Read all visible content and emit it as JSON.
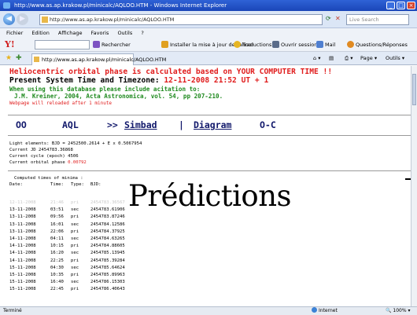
{
  "window": {
    "title": "http://www.as.ap.krakow.pl/minicalc/AQLOO.HTM - Windows Internet Explorer"
  },
  "address": {
    "url": "http://www.as.ap.krakow.pl/minicalc/AQLOO.HTM",
    "search_placeholder": "Live Search"
  },
  "menu": [
    "Fichier",
    "Edition",
    "Affichage",
    "Favoris",
    "Outils",
    "?"
  ],
  "yahoo_toolbar": {
    "logo": "Y!",
    "search_label": "Rechercher",
    "install_label": "Installer la mise à jour de Yahoo!",
    "translate_label": "Traductions",
    "open_session_label": "Ouvrir session",
    "mail_label": "Mail",
    "answers_label": "Questions/Réponses"
  },
  "tab": {
    "label": "http://www.as.ap.krakow.pl/minicalc/AQLOO.HTM"
  },
  "commands": {
    "page": "Page",
    "tools": "Outils"
  },
  "page": {
    "heading_red": "Heliocentric orbital phase is calculated based on YOUR COMPUTER TIME !!",
    "heading_label": "Present System Time and Timezone:",
    "heading_time": "12-11-2008 21:52  UT + 1",
    "cite_line1": "When using this database please include acitation to:",
    "cite_line2": "J.M. Kreiner, 2004,  Acta Astronomica, vol. 54, pp 207-210.",
    "refresh_note": "Webpage will reloaded after 1 minute",
    "nav": {
      "oo": "OO",
      "aql": "AQL",
      "sep1": ">>",
      "simbad": "Simbad",
      "sep2": "|",
      "diagram": "Diagram",
      "oc": "O-C"
    },
    "elements": {
      "line1": "Light elements:  BJD = 2452500.2614 + E x 0.5067954",
      "line2": "Current JD 2454783.36868",
      "line3": "Current cycle (epoch) 4506",
      "line4_label": "Current orbital phase",
      "line4_value": "0.00792"
    },
    "computed_label": "Computed times of minima :",
    "table_headers": [
      "Date:",
      "Time:",
      "Type:",
      "BJD:"
    ],
    "minima": [
      {
        "date": "12-11-2008",
        "time": "21:46",
        "type": "pri",
        "bjd": "2454783.36567",
        "faded": true
      },
      {
        "date": "13-11-2008",
        "time": "03:51",
        "type": "sec",
        "bjd": "2454783.61906"
      },
      {
        "date": "13-11-2008",
        "time": "09:56",
        "type": "pri",
        "bjd": "2454783.87246"
      },
      {
        "date": "13-11-2008",
        "time": "16:01",
        "type": "sec",
        "bjd": "2454784.12586"
      },
      {
        "date": "13-11-2008",
        "time": "22:06",
        "type": "pri",
        "bjd": "2454784.37925"
      },
      {
        "date": "14-11-2008",
        "time": "04:11",
        "type": "sec",
        "bjd": "2454784.63265"
      },
      {
        "date": "14-11-2008",
        "time": "10:15",
        "type": "pri",
        "bjd": "2454784.88605"
      },
      {
        "date": "14-11-2008",
        "time": "16:20",
        "type": "sec",
        "bjd": "2454785.13945"
      },
      {
        "date": "14-11-2008",
        "time": "22:25",
        "type": "pri",
        "bjd": "2454785.39284"
      },
      {
        "date": "15-11-2008",
        "time": "04:30",
        "type": "sec",
        "bjd": "2454785.64624"
      },
      {
        "date": "15-11-2008",
        "time": "10:35",
        "type": "pri",
        "bjd": "2454785.89963"
      },
      {
        "date": "15-11-2008",
        "time": "16:40",
        "type": "sec",
        "bjd": "2454786.15303"
      },
      {
        "date": "15-11-2008",
        "time": "22:45",
        "type": "pri",
        "bjd": "2454786.40643"
      }
    ],
    "overlay_title": "Prédictions"
  },
  "status": {
    "done": "Terminé",
    "zone": "Internet",
    "zoom": "100%"
  },
  "colors": {
    "heading_red": "#e01d1d",
    "cite_green": "#1f8a1f",
    "nav_navy": "#11186b"
  }
}
